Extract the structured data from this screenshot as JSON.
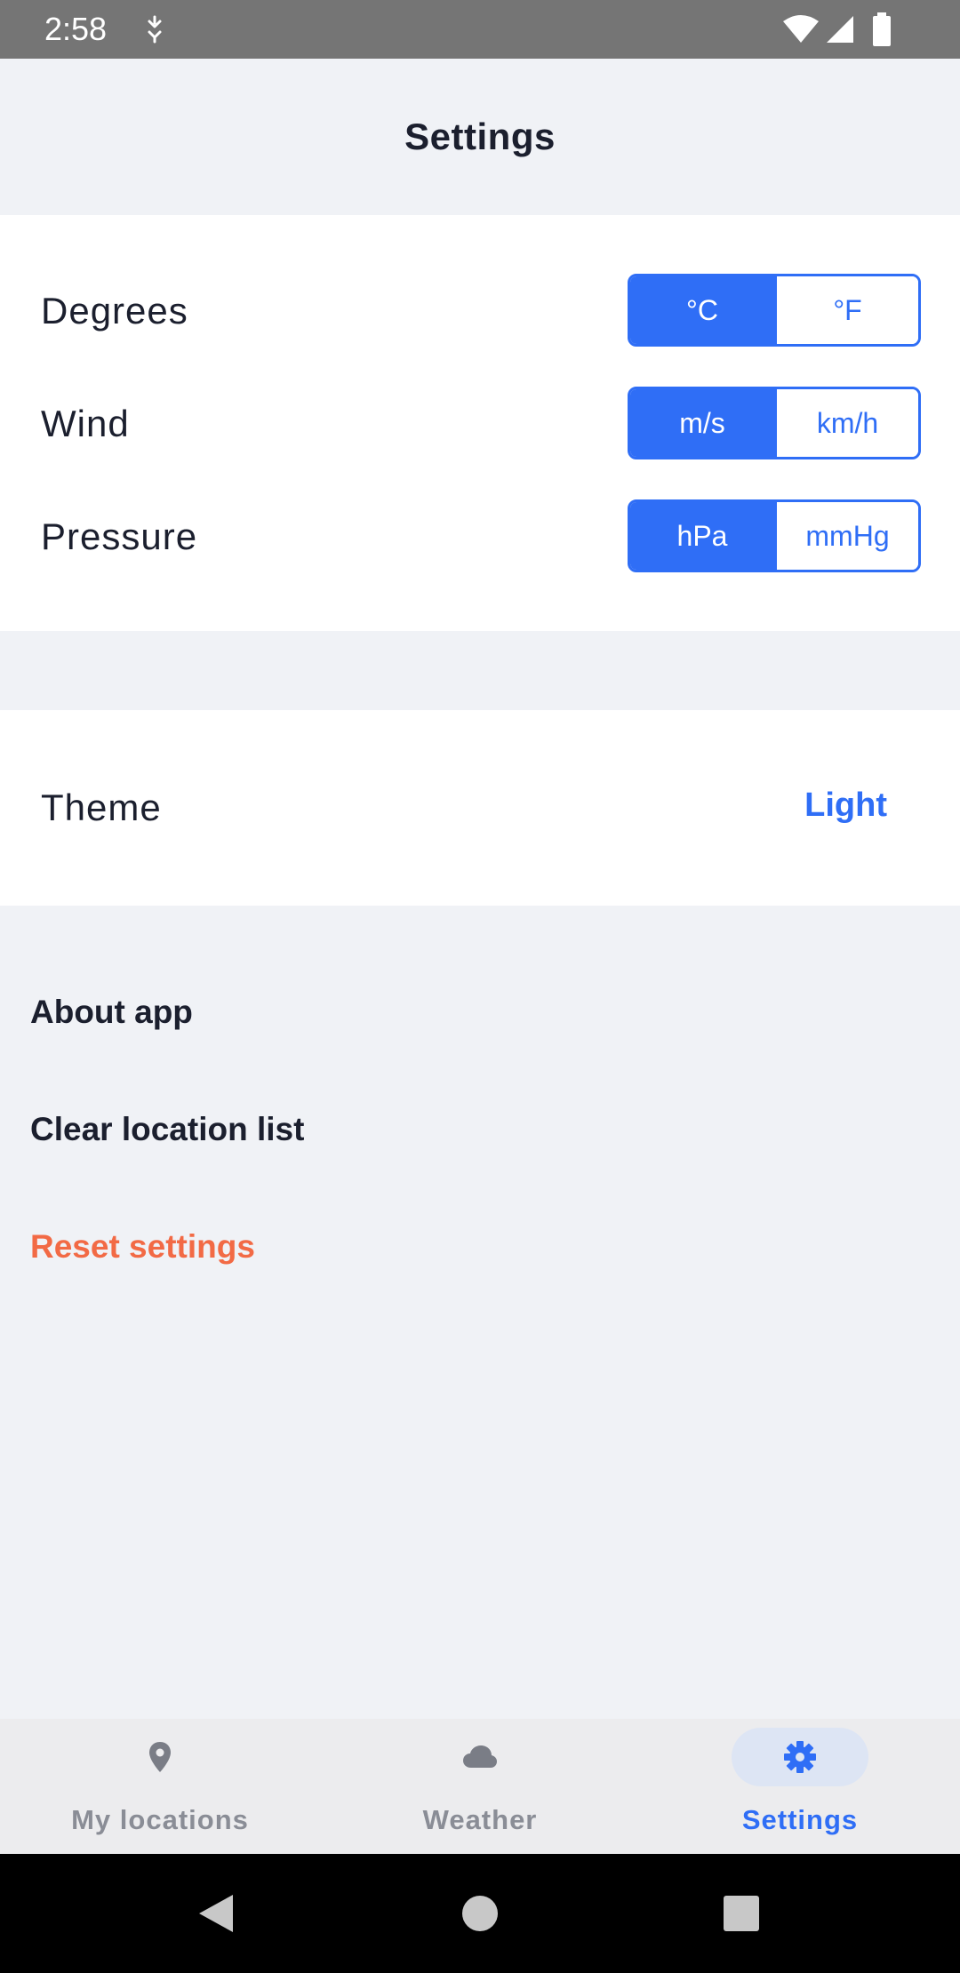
{
  "status_bar": {
    "time": "2:58",
    "icons": [
      "sync-icon",
      "wifi-icon",
      "cell-signal-icon",
      "battery-icon"
    ]
  },
  "header": {
    "title": "Settings"
  },
  "units": {
    "degrees": {
      "label": "Degrees",
      "options": [
        "°C",
        "°F"
      ],
      "selected": "°C"
    },
    "wind": {
      "label": "Wind",
      "options": [
        "m/s",
        "km/h"
      ],
      "selected": "m/s"
    },
    "pressure": {
      "label": "Pressure",
      "options": [
        "hPa",
        "mmHg"
      ],
      "selected": "hPa"
    }
  },
  "theme": {
    "label": "Theme",
    "value": "Light"
  },
  "actions": {
    "about": "About app",
    "clear_locations": "Clear location list",
    "reset": "Reset settings"
  },
  "bottom_nav": {
    "items": [
      {
        "label": "My locations",
        "icon": "location-pin-icon",
        "active": false
      },
      {
        "label": "Weather",
        "icon": "cloud-icon",
        "active": false
      },
      {
        "label": "Settings",
        "icon": "gear-icon",
        "active": true
      }
    ]
  },
  "system_nav": {
    "icons": [
      "back-icon",
      "home-icon",
      "recents-icon"
    ]
  },
  "colors": {
    "accent": "#2f6ef6",
    "danger": "#f26a45",
    "background": "#f0f2f6",
    "text": "#1b1f2e",
    "muted": "#8a8d96",
    "status_bar": "#757575"
  }
}
